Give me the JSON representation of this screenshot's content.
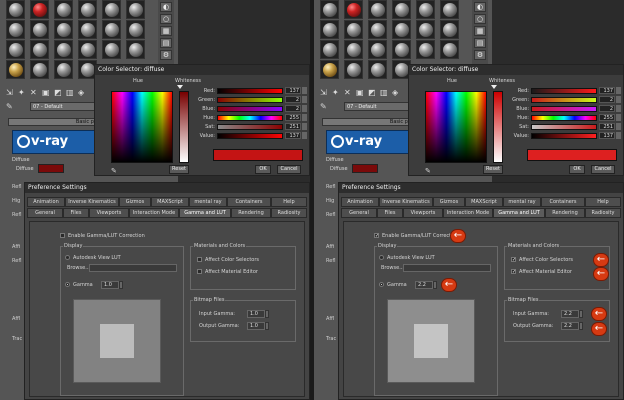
{
  "color_selector": {
    "title": "Color Selector: diffuse",
    "hue_label": "Hue",
    "whiteness_label": "Whiteness",
    "sliders": [
      {
        "label": "Red:",
        "value": "137"
      },
      {
        "label": "Green:",
        "value": "2"
      },
      {
        "label": "Blue:",
        "value": "2"
      },
      {
        "label": "Hue:",
        "value": "255"
      },
      {
        "label": "Sat:",
        "value": "251"
      },
      {
        "label": "Value:",
        "value": "137"
      }
    ],
    "reset_label": "Reset",
    "ok_label": "OK",
    "cancel_label": "Cancel",
    "swatch_color": "#c41414"
  },
  "material_editor": {
    "material_name": "07 - Default",
    "rollout_label": "Basic para",
    "vray_label": "v-ray",
    "vray_suffix": "V-",
    "diffuse_header": "Diffuse",
    "diffuse_label": "Diffuse",
    "side_labels": [
      "Refl",
      "Hig",
      "Refl",
      "Affi",
      "Refl",
      "Affl",
      "Trac"
    ]
  },
  "preferences": {
    "title": "Preference Settings",
    "tabs_top": [
      "Animation",
      "Inverse Kinematics",
      "Gizmos",
      "MAXScript",
      "mental ray",
      "Containers",
      "Help"
    ],
    "tabs_bottom": [
      "General",
      "Files",
      "Viewports",
      "Interaction Mode",
      "Gamma and LUT",
      "Rendering",
      "Radiosity"
    ],
    "enable_gamma_label": "Enable Gamma/LUT Correction",
    "display_label": "Display",
    "autodesk_lut_label": "Autodesk View LUT",
    "browse_label": "Browse...",
    "gamma_label": "Gamma",
    "gamma_value_left": "1.0",
    "gamma_value_right": "2.2",
    "materials_colors_label": "Materials and Colors",
    "affect_color_selectors": "Affect Color Selectors",
    "affect_material_editor": "Affect Material Editor",
    "bitmap_files_label": "Bitmap Files",
    "input_gamma_label": "Input Gamma:",
    "output_gamma_label": "Output Gamma:",
    "input_gamma_left": "1.0",
    "output_gamma_left": "1.0",
    "input_gamma_right": "2.2",
    "output_gamma_right": "2.2"
  },
  "colors": {
    "accent_arrow": "#d63a12",
    "vray_blue": "#1c5ea8"
  }
}
